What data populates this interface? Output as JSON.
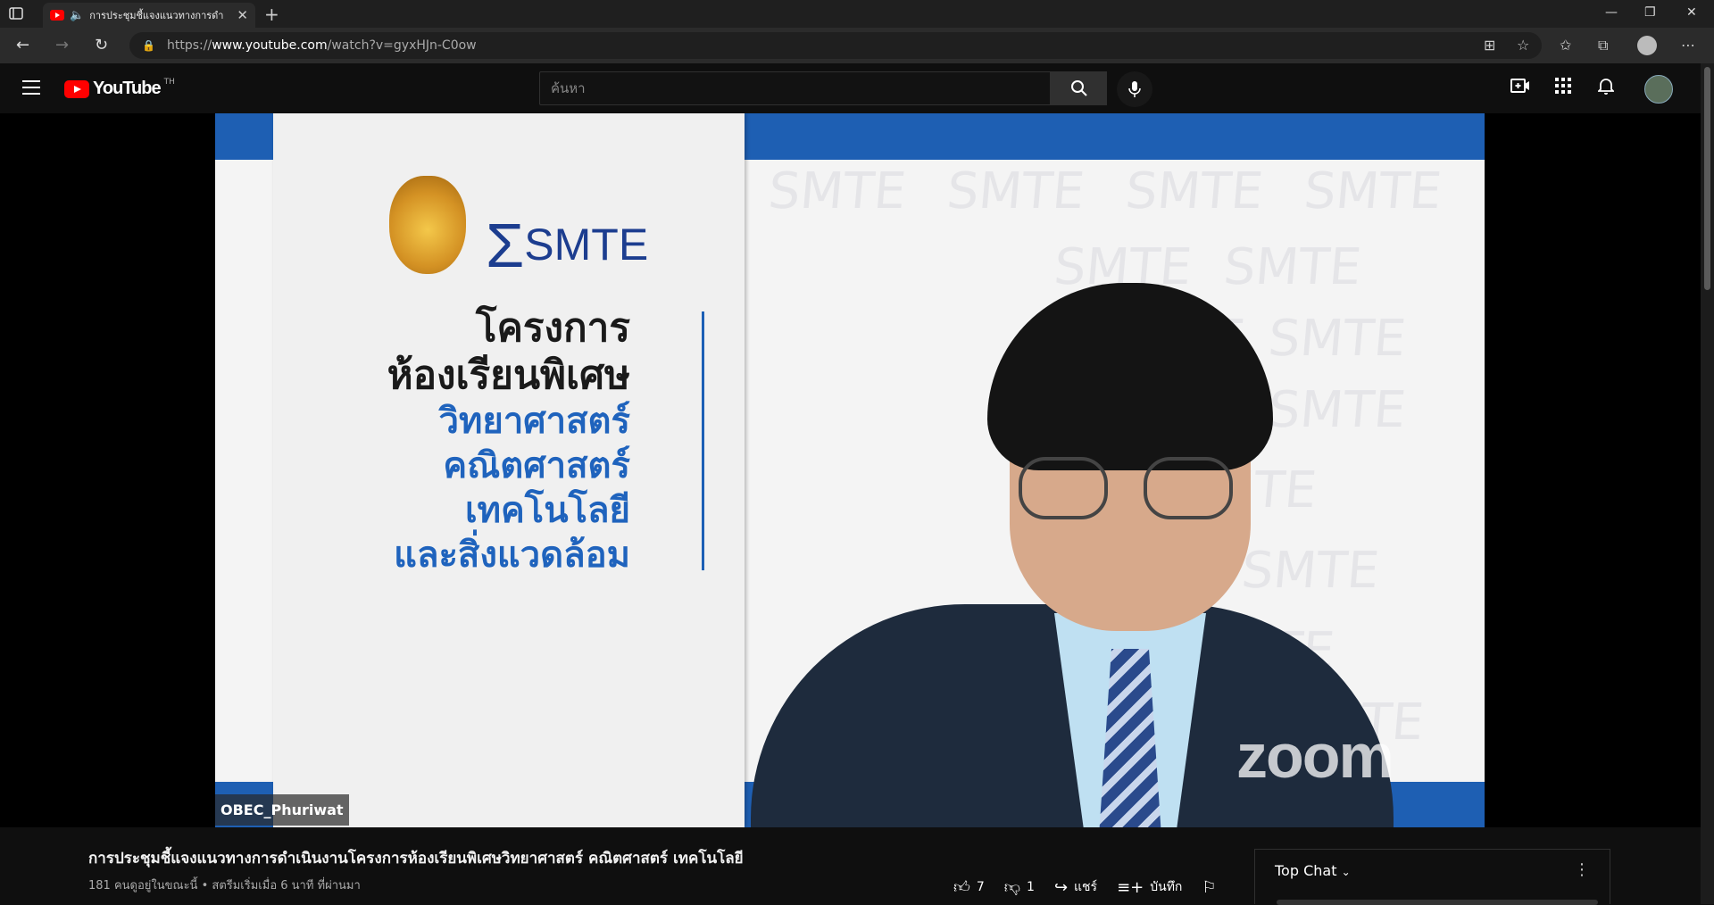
{
  "browser": {
    "tab_title": "การประชุมชี้แจงแนวทางการดำเนิ",
    "url_prefix": "https://",
    "url_host": "www.youtube.com",
    "url_path": "/watch?v=gyxHJn-C0ow"
  },
  "youtube": {
    "logo_text": "YouTube",
    "region_code": "TH",
    "search_placeholder": "ค้นหา"
  },
  "video": {
    "panel_title_1": "โครงการ",
    "panel_title_2": "ห้องเรียนพิเศษ",
    "panel_sub_1": "วิทยาศาสตร์",
    "panel_sub_2": "คณิตศาสตร์",
    "panel_sub_3": "เทคโนโลยี",
    "panel_sub_4": "และสิ่งแวดล้อม",
    "smte_text": "SMTE",
    "watermark_text": "SMTE",
    "zoom_text": "zoom",
    "speaker_name": "OBEC_Phuriwat"
  },
  "info": {
    "title": "การประชุมชี้แจงแนวทางการดำเนินงานโครงการห้องเรียนพิเศษวิทยาศาสตร์ คณิตศาสตร์ เทคโนโลยี",
    "meta": "181 คนดูอยู่ในขณะนี้ • สตรีมเริ่มเมื่อ 6 นาที ที่ผ่านมา",
    "likes": "7",
    "dislikes": "1",
    "share_label": "แชร์",
    "save_label": "บันทึก"
  },
  "chat": {
    "header": "Top Chat"
  }
}
